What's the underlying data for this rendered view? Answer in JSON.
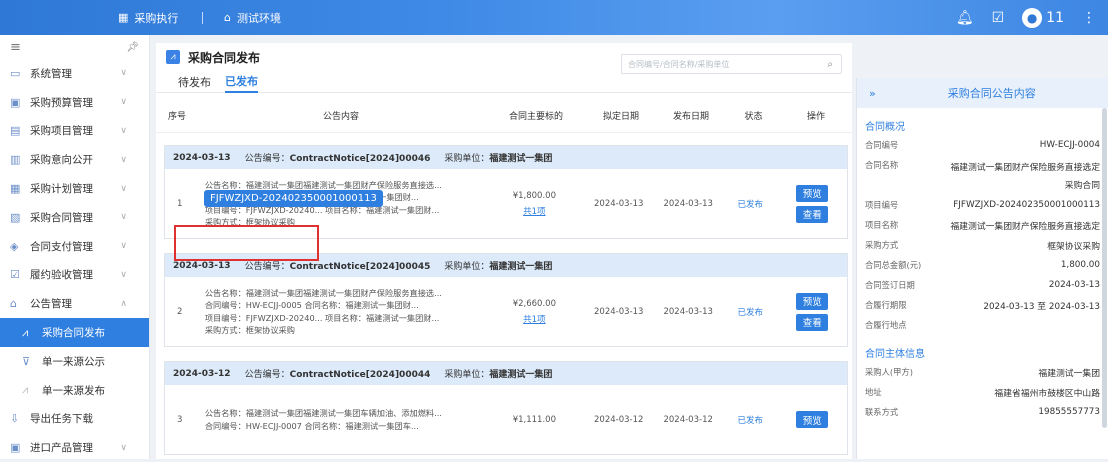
{
  "topbar": {
    "module": "采购执行",
    "env": "测试环境",
    "user": "11"
  },
  "sidebar": {
    "items": [
      {
        "label": "系统管理",
        "icon": "monitor-icon"
      },
      {
        "label": "采购预算管理",
        "icon": "budget-icon"
      },
      {
        "label": "采购项目管理",
        "icon": "project-icon"
      },
      {
        "label": "采购意向公开",
        "icon": "intent-icon"
      },
      {
        "label": "采购计划管理",
        "icon": "plan-icon"
      },
      {
        "label": "采购合同管理",
        "icon": "contract-icon"
      },
      {
        "label": "合同支付管理",
        "icon": "payment-icon"
      },
      {
        "label": "履约验收管理",
        "icon": "check-icon"
      },
      {
        "label": "公告管理",
        "icon": "announce-icon"
      },
      {
        "label": "采购合同发布",
        "icon": "chart-icon"
      },
      {
        "label": "单一来源公示",
        "icon": "cart-icon"
      },
      {
        "label": "单一来源发布",
        "icon": "chart-icon"
      },
      {
        "label": "导出任务下载",
        "icon": "download-icon"
      },
      {
        "label": "进口产品管理",
        "icon": "import-icon"
      }
    ]
  },
  "main": {
    "title": "采购合同发布",
    "search_placeholder": "合同编号/合同名称/采购单位",
    "tabs": [
      "待发布",
      "已发布"
    ],
    "columns": [
      "序号",
      "公告内容",
      "合同主要标的",
      "拟定日期",
      "发布日期",
      "状态",
      "操作"
    ],
    "groups": [
      {
        "date": "2024-03-13",
        "notice_label": "公告编号：",
        "notice": "ContractNotice[2024]00046",
        "unit_label": "采购单位：",
        "unit": "福建测试一集团",
        "row": {
          "idx": "1",
          "line1": "公告名称：福建测试一集团福建测试一集团财产保险服务直接选...",
          "line2": "合同编号：HW-ECJJ-0004        合同名称：福建测试一集团财...",
          "line3": "项目编号：FJFWZJXD-20240...   项目名称：福建测试一集团财...",
          "line4": "采购方式：框架协议采购",
          "amount": "¥1,800.00",
          "items": "共1项",
          "draft": "2024-03-13",
          "pub": "2024-03-13",
          "status": "已发布",
          "preview": "预览",
          "view": "查看"
        }
      },
      {
        "date": "2024-03-13",
        "notice_label": "公告编号：",
        "notice": "ContractNotice[2024]00045",
        "unit_label": "采购单位：",
        "unit": "福建测试一集团",
        "row": {
          "idx": "2",
          "line1": "公告名称：福建测试一集团福建测试一集团财产保险服务直接选...",
          "line2": "合同编号：HW-ECJJ-0005        合同名称：福建测试一集团财...",
          "line3": "项目编号：FJFWZJXD-20240...   项目名称：福建测试一集团财...",
          "line4": "采购方式：框架协议采购",
          "amount": "¥2,660.00",
          "items": "共1项",
          "draft": "2024-03-13",
          "pub": "2024-03-13",
          "status": "已发布",
          "preview": "预览",
          "view": "查看"
        }
      },
      {
        "date": "2024-03-12",
        "notice_label": "公告编号：",
        "notice": "ContractNotice[2024]00044",
        "unit_label": "采购单位：",
        "unit": "福建测试一集团",
        "row": {
          "idx": "3",
          "line1": "公告名称：福建测试一集团福建测试一集团车辆加油、添加燃料...",
          "line2": "合同编号：HW-ECJJ-0007        合同名称：福建测试一集团车...",
          "line3": "",
          "line4": "",
          "amount": "¥1,111.00",
          "items": "",
          "draft": "2024-03-12",
          "pub": "2024-03-12",
          "status": "已发布",
          "preview": "预览",
          "view": ""
        }
      }
    ],
    "tooltip": "FJFWZJXD-202402350001000113"
  },
  "panel": {
    "title": "采购合同公告内容",
    "sec1": "合同概况",
    "rows1": [
      {
        "k": "合同编号",
        "v": "HW-ECJJ-0004"
      },
      {
        "k": "合同名称",
        "v": "福建测试一集团财产保险服务直接选定采购合同"
      },
      {
        "k": "项目编号",
        "v": "FJFWZJXD-202402350001000113"
      },
      {
        "k": "项目名称",
        "v": "福建测试一集团财产保险服务直接选定"
      },
      {
        "k": "采购方式",
        "v": "框架协议采购"
      },
      {
        "k": "合同总金额(元)",
        "v": "1,800.00"
      },
      {
        "k": "合同签订日期",
        "v": "2024-03-13"
      },
      {
        "k": "合履行期限",
        "v": "2024-03-13 至 2024-03-13"
      },
      {
        "k": "合履行地点",
        "v": ""
      }
    ],
    "sec2": "合同主体信息",
    "rows2": [
      {
        "k": "采购人(甲方)",
        "v": "福建测试一集团"
      },
      {
        "k": "地址",
        "v": "福建省福州市鼓楼区中山路"
      },
      {
        "k": "联系方式",
        "v": "19855557773"
      }
    ]
  }
}
